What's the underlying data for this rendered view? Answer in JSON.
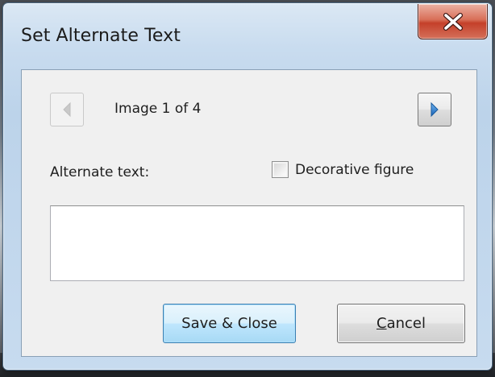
{
  "window": {
    "title": "Set Alternate Text"
  },
  "navigation": {
    "prev_icon": "triangle-left-icon",
    "next_icon": "triangle-right-icon",
    "counter": "Image 1 of 4"
  },
  "form": {
    "alt_label": "Alternate text:",
    "alt_value": "",
    "decorative_label": "Decorative figure",
    "decorative_checked": false
  },
  "buttons": {
    "save_label": "Save & Close",
    "cancel_mnemonic": "C",
    "cancel_rest": "ancel"
  },
  "colors": {
    "close_button_red": "#c4402a",
    "next_arrow_blue": "#2f7fd0",
    "default_button_border": "#3c7fb1"
  }
}
